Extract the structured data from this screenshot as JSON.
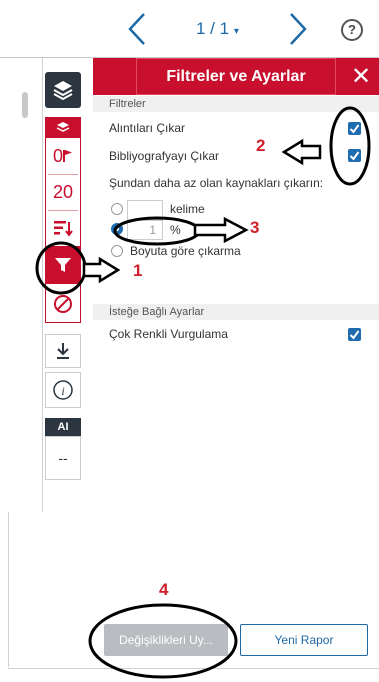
{
  "nav": {
    "page_indicator": "1 / 1",
    "prev_icon": "chevron-left-icon",
    "next_icon": "chevron-right-icon",
    "help_glyph": "?"
  },
  "toolbar": {
    "layers_icon": "layers-icon",
    "match_count": "0",
    "word_count": "20",
    "ai_label": "AI",
    "ai_value": "--"
  },
  "panel": {
    "title": "Filtreler ve Ayarlar",
    "filters_section": "Filtreler",
    "exclude_quotes": "Alıntıları Çıkar",
    "exclude_bibliography": "Bibliyografyayı Çıkar",
    "exclude_small_sources": "Şundan daha az olan kaynakları çıkarın:",
    "words_unit": "kelime",
    "percent_value": "1",
    "percent_unit": "%",
    "no_size_exclusion": "Boyuta göre çıkarma",
    "optional_section": "İsteğe Bağlı Ayarlar",
    "multicolor_highlight": "Çok Renkli Vurgulama"
  },
  "footer": {
    "apply_label": "Değişiklikleri Uy...",
    "new_report_label": "Yeni Rapor"
  },
  "annotations": [
    "1",
    "2",
    "3",
    "4"
  ],
  "colors": {
    "accent": "#c8102e",
    "link": "#1e6aa8",
    "checkbox": "#1f6bb0",
    "annotation": "#d11f2a"
  }
}
